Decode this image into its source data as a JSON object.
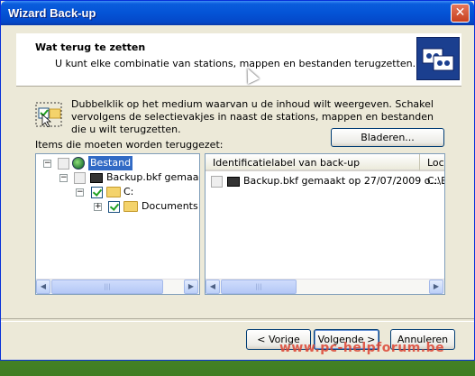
{
  "window": {
    "title": "Wizard Back-up",
    "close_glyph": "✕"
  },
  "header": {
    "title": "Wat terug te zetten",
    "subtitle": "U kunt elke combinatie van stations, mappen en bestanden terugzetten.",
    "icon": "backup-tapes-icon"
  },
  "instruction": "Dubbelklik op het medium waarvan u de inhoud wilt weergeven. Schakel vervolgens de selectievakjes in naast de stations, mappen en bestanden die u wilt terugzetten.",
  "browse_button": "Bladeren...",
  "items_label": "Items die moeten worden teruggezet:",
  "tree": [
    {
      "label": "Bestand",
      "expander": "−",
      "checked": false,
      "icon": "file-media-icon",
      "selected": true
    },
    {
      "label": "Backup.bkf gemaakt",
      "expander": "−",
      "checked": false,
      "icon": "backup-file-icon"
    },
    {
      "label": "C:",
      "expander": "−",
      "checked": true,
      "icon": "drive-folder-icon"
    },
    {
      "label": "Documents a",
      "expander": "+",
      "checked": true,
      "icon": "folder-icon"
    }
  ],
  "list": {
    "columns": [
      "Identificatielabel van back-up",
      "Loc"
    ],
    "rows": [
      {
        "label": "Backup.bkf gemaakt op 27/07/2009 o...",
        "location": "C:\\E"
      }
    ]
  },
  "scroll": {
    "left": "◀",
    "right": "▶",
    "grip": "|||"
  },
  "buttons": {
    "back": "< Vorige",
    "next": "Volgende >",
    "cancel": "Annuleren"
  },
  "watermark": "www.pc-helpforum.be"
}
